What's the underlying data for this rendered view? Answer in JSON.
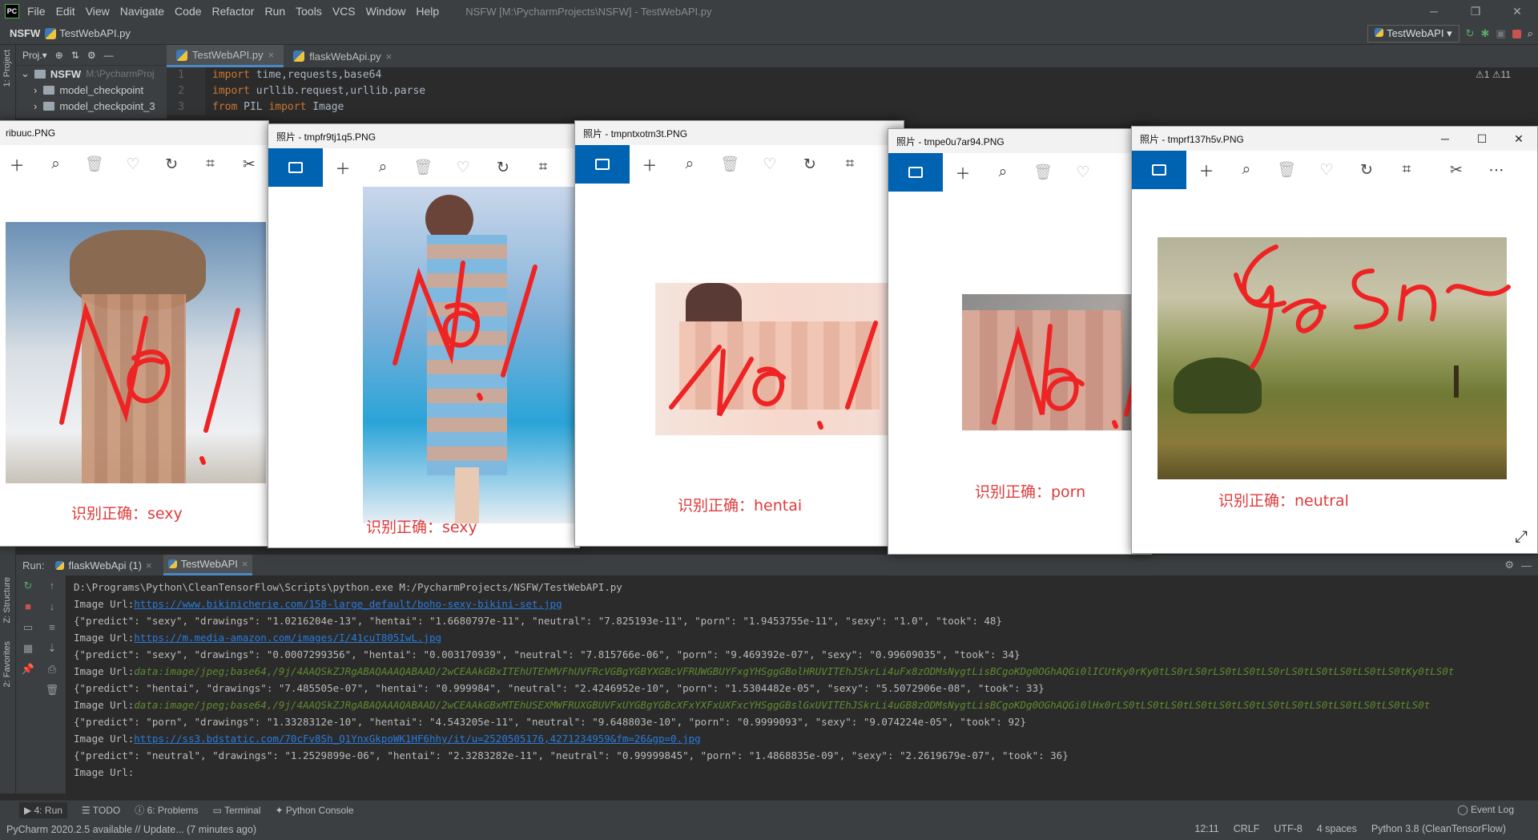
{
  "ide": {
    "title_bar": {
      "logo": "PC",
      "menu": [
        "File",
        "Edit",
        "View",
        "Navigate",
        "Code",
        "Refactor",
        "Run",
        "Tools",
        "VCS",
        "Window",
        "Help"
      ],
      "window_title": "NSFW [M:\\PycharmProjects\\NSFW] - TestWebAPI.py"
    },
    "nav": {
      "project": "NSFW",
      "file": "TestWebAPI.py",
      "run_config": "TestWebAPI"
    },
    "project_panel": {
      "label": "Proj.▾",
      "tree": [
        {
          "name": "NSFW",
          "hint": "M:\\PycharmProj"
        },
        {
          "name": "model_checkpoint"
        },
        {
          "name": "model_checkpoint_3"
        }
      ]
    },
    "editor_tabs": [
      "TestWebAPI.py",
      "flaskWebApi.py"
    ],
    "code_lines": [
      {
        "num": "1",
        "kw": "import",
        "rest": " time,requests,base64"
      },
      {
        "num": "2",
        "kw": "import",
        "rest": " urllib.request,urllib.parse"
      },
      {
        "num": "3",
        "kw": "from",
        "rest": " PIL ",
        "kw2": "import",
        "rest2": " Image"
      }
    ],
    "inspections": "⚠1  ⚠11",
    "side_tabs": {
      "project": "1: Project",
      "structure": "Z: Structure",
      "favorites": "2: Favorites"
    },
    "run_panel": {
      "label": "Run:",
      "tabs": [
        "flaskWebApi (1)",
        "TestWebAPI"
      ],
      "console": [
        {
          "type": "text",
          "text": "D:\\Programs\\Python\\CleanTensorFlow\\Scripts\\python.exe M:/PycharmProjects/NSFW/TestWebAPI.py"
        },
        {
          "type": "url",
          "prefix": "Image Url:",
          "link": "https://www.bikinicherie.com/158-large_default/boho-sexy-bikini-set.jpg"
        },
        {
          "type": "text",
          "text": "{\"predict\": \"sexy\", \"drawings\": \"1.0216204e-13\", \"hentai\": \"1.6680797e-11\", \"neutral\": \"7.825193e-11\", \"porn\": \"1.9453755e-11\", \"sexy\": \"1.0\", \"took\": 48}"
        },
        {
          "type": "url",
          "prefix": "Image Url:",
          "link": "https://m.media-amazon.com/images/I/41cuT805IwL.jpg"
        },
        {
          "type": "text",
          "text": "{\"predict\": \"sexy\", \"drawings\": \"0.0007299356\", \"hentai\": \"0.003170939\", \"neutral\": \"7.815766e-06\", \"porn\": \"9.469392e-07\", \"sexy\": \"0.99609035\", \"took\": 34}"
        },
        {
          "type": "b64",
          "prefix": "Image Url:",
          "link": "data:image/jpeg;base64,/9j/4AAQSkZJRgABAQAAAQABAAD/2wCEAAkGBxITEhUTEhMVFhUVFRcVGBgYGBYXGBcVFRUWGBUYFxgYHSggGBolHRUVITEhJSkrLi4uFx8zODMsNygtLisBCgoKDg0OGhAQGi0lICUtKy0rKy0tLS0rLS0rLS0tLS0tLS0rLS0tLS0tLS0tLS0tLS0tKy0tLS0t"
        },
        {
          "type": "text",
          "text": "{\"predict\": \"hentai\", \"drawings\": \"7.485505e-07\", \"hentai\": \"0.999984\", \"neutral\": \"2.4246952e-10\", \"porn\": \"1.5304482e-05\", \"sexy\": \"5.5072906e-08\", \"took\": 33}"
        },
        {
          "type": "b64",
          "prefix": "Image Url:",
          "link": "data:image/jpeg;base64,/9j/4AAQSkZJRgABAQAAAQABAAD/2wCEAAkGBxMTEhUSEXMWFRUXGBUVFxUYGBgYGBcXFxYXFxUXFxcYHSggGBslGxUVITEhJSkrLi4uGB8zODMsNygtLisBCgoKDg0OGhAQGi0lHx0rLS0tLS0tLS0tLS0tLS0tLS0tLS0tLS0tLS0tLS0tLS0tLS0tLS0t"
        },
        {
          "type": "text",
          "text": "{\"predict\": \"porn\", \"drawings\": \"1.3328312e-10\", \"hentai\": \"4.543205e-11\", \"neutral\": \"9.648803e-10\", \"porn\": \"0.9999093\", \"sexy\": \"9.074224e-05\", \"took\": 92}"
        },
        {
          "type": "url",
          "prefix": "Image Url:",
          "link": "https://ss3.bdstatic.com/70cFv8Sh_Q1YnxGkpoWK1HF6hhy/it/u=2520505176,4271234959&fm=26&gp=0.jpg"
        },
        {
          "type": "text",
          "text": "{\"predict\": \"neutral\", \"drawings\": \"1.2529899e-06\", \"hentai\": \"2.3283282e-11\", \"neutral\": \"0.99999845\", \"porn\": \"1.4868835e-09\", \"sexy\": \"2.2619679e-07\", \"took\": 36}"
        },
        {
          "type": "text",
          "text": "Image Url:"
        }
      ]
    },
    "tool_tabs": [
      "4: Run",
      "TODO",
      "6: Problems",
      "Terminal",
      "Python Console"
    ],
    "event_log": "Event Log",
    "status": {
      "message": "PyCharm 2020.2.5 available // Update... (7 minutes ago)",
      "position": "12:11",
      "line_sep": "CRLF",
      "encoding": "UTF-8",
      "indent": "4 spaces",
      "interpreter": "Python 3.8 (CleanTensorFlow)"
    }
  },
  "photo_windows": [
    {
      "title": "ribuuc.PNG",
      "caption": "识别正确：sexy",
      "scribble": "No!"
    },
    {
      "title": "照片 - tmpfr9tj1q5.PNG",
      "caption": "识别正确：sexy",
      "scribble": "No!"
    },
    {
      "title": "照片 - tmpntxotm3t.PNG",
      "caption": "识别正确：hentai",
      "scribble": "No!"
    },
    {
      "title": "照片 - tmpe0u7ar94.PNG",
      "caption": "识别正确：porn",
      "scribble": "No!"
    },
    {
      "title": "照片 - tmprf137h5v.PNG",
      "caption": "识别正确：neutral",
      "scribble": "yes~"
    }
  ],
  "colors": {
    "accent": "#0063b1",
    "caption": "#e03a3a",
    "ide_bg": "#2b2b2b",
    "ide_panel": "#3c3f41",
    "link": "#287bde"
  }
}
